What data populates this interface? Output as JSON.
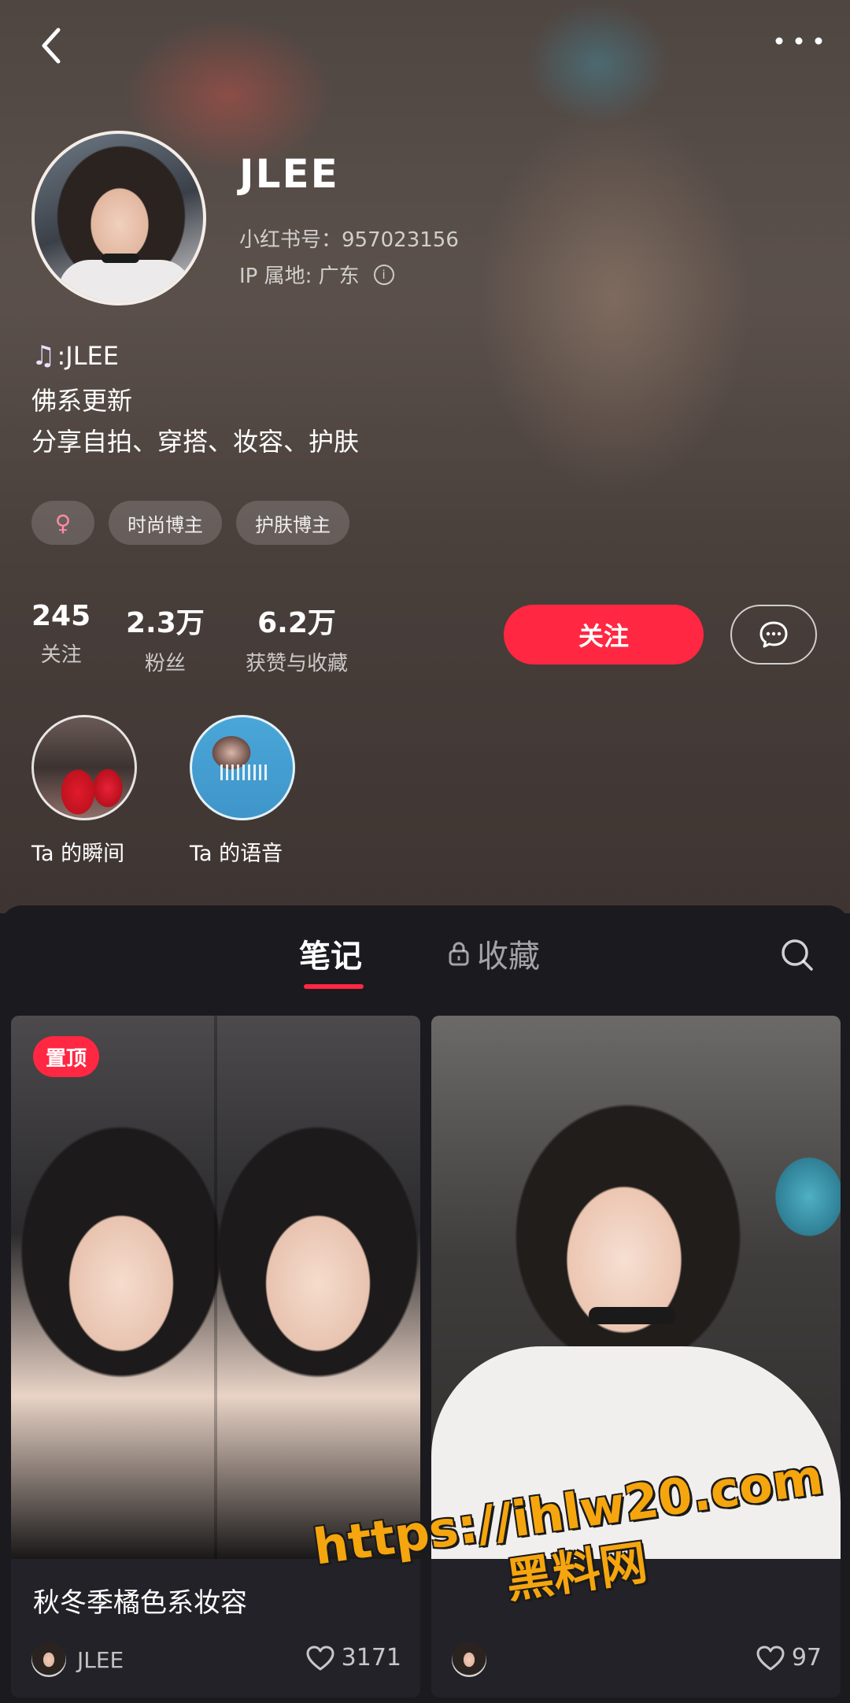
{
  "profile": {
    "name": "JLEE",
    "redid_label": "小红书号：957023156",
    "ip_label": "IP 属地: 广东",
    "bio_line1": ":JLEE",
    "bio_line2": "佛系更新",
    "bio_line3": "分享自拍、穿搭、妆容、护肤",
    "tags": [
      "♀",
      "时尚博主",
      "护肤博主"
    ]
  },
  "stats": [
    {
      "num": "245",
      "label": "关注"
    },
    {
      "num": "2.3万",
      "label": "粉丝"
    },
    {
      "num": "6.2万",
      "label": "获赞与收藏"
    }
  ],
  "actions": {
    "follow_label": "关注"
  },
  "moments": [
    {
      "label": "Ta 的瞬间"
    },
    {
      "label": "Ta 的语音"
    }
  ],
  "tabs": {
    "notes": "笔记",
    "collections": "收藏"
  },
  "cards": [
    {
      "badge": "置顶",
      "title": "秋冬季橘色系妆容",
      "author": "JLEE",
      "likes": "3171"
    },
    {
      "title": "",
      "author": "",
      "likes": "97"
    }
  ],
  "watermark": {
    "url": "https://ihlw20.com",
    "name": "黑料网"
  },
  "colors": {
    "accent": "#ff2742",
    "watermark": "#f5a50e"
  },
  "icons": [
    "back-icon",
    "more-icon",
    "info-icon",
    "music-icon",
    "message-icon",
    "lock-icon",
    "search-icon",
    "heart-icon"
  ]
}
